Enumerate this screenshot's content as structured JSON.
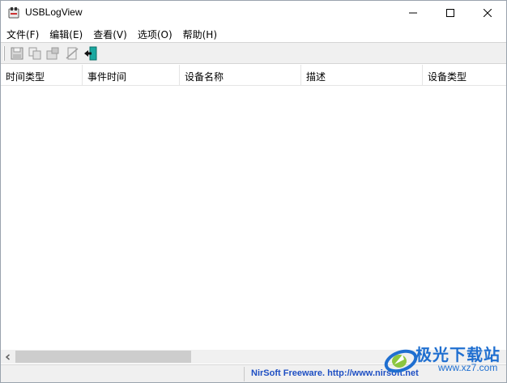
{
  "window": {
    "title": "USBLogView"
  },
  "caption": {
    "minimize": "—",
    "maximize": "☐",
    "close": "✕"
  },
  "menu": [
    {
      "label": "文件(F)"
    },
    {
      "label": "编辑(E)"
    },
    {
      "label": "查看(V)"
    },
    {
      "label": "选项(O)"
    },
    {
      "label": "帮助(H)"
    }
  ],
  "toolbar": {
    "icons": [
      "save-icon",
      "copy-icon",
      "properties-icon",
      "html-report-icon",
      "exit-icon"
    ]
  },
  "columns": [
    {
      "label": "时间类型"
    },
    {
      "label": "事件时间"
    },
    {
      "label": "设备名称"
    },
    {
      "label": "描述"
    },
    {
      "label": "设备类型"
    }
  ],
  "status": {
    "text": "NirSoft Freeware.  http://www.nirsoft.net"
  },
  "watermark": {
    "line1": "极光下载站",
    "line2": "www.xz7.com"
  },
  "colors": {
    "status_link": "#1e4fc3",
    "toolbar_bg": "#f0f0f0",
    "exit_icon": "#1aa8a0"
  }
}
